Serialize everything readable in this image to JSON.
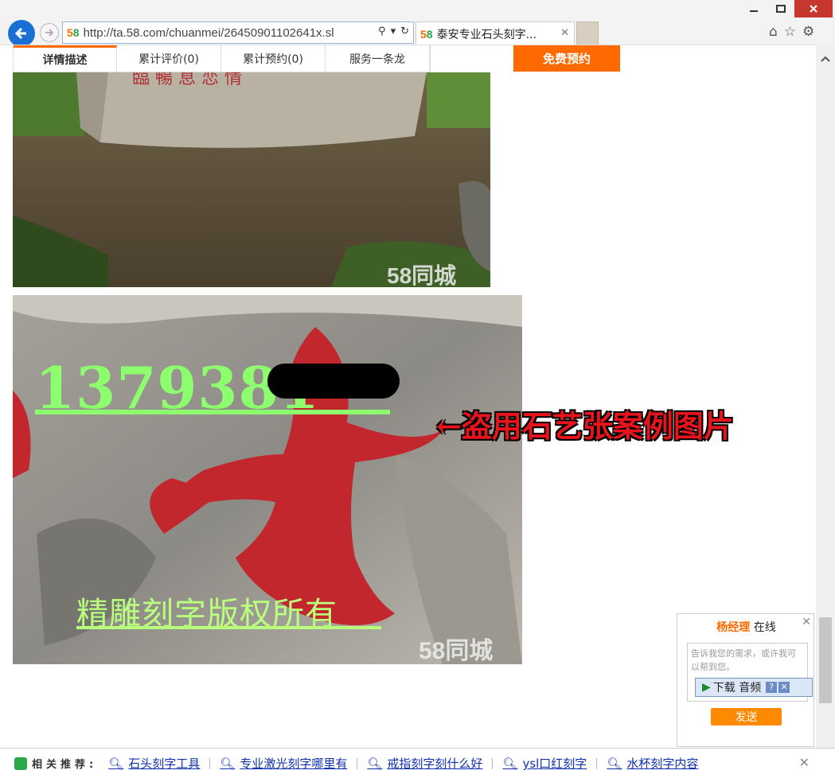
{
  "browser": {
    "url": "http://ta.58.com/chuanmei/26450901102641x.sl",
    "tab_title": "泰安专业石头刻字..."
  },
  "detail_tabs": [
    {
      "label": "详情描述"
    },
    {
      "label": "累计评价(0)"
    },
    {
      "label": "累计预约(0)"
    },
    {
      "label": "服务一条龙"
    }
  ],
  "book_button": "免费预约",
  "photo2": {
    "phone_visible": "1379381",
    "copyright": "精雕刻字版权所有"
  },
  "watermark": "58同城",
  "annotation": "←盗用石艺张案例图片",
  "chat": {
    "name": "杨经理",
    "status": "在线",
    "placeholder": "告诉我您的需求，或许我可以帮到您。",
    "send": "发送",
    "audio_label": "下载 音频"
  },
  "recommend": {
    "label": "相关推荐:",
    "items": [
      "石头刻字工具",
      "专业激光刻字哪里有",
      "戒指刻字刻什么好",
      "ysl口红刻字",
      "水杯刻字内容"
    ]
  },
  "colors": {
    "accent": "#ff6a00",
    "link": "#1030b0",
    "back_button": "#1a6fd4"
  }
}
